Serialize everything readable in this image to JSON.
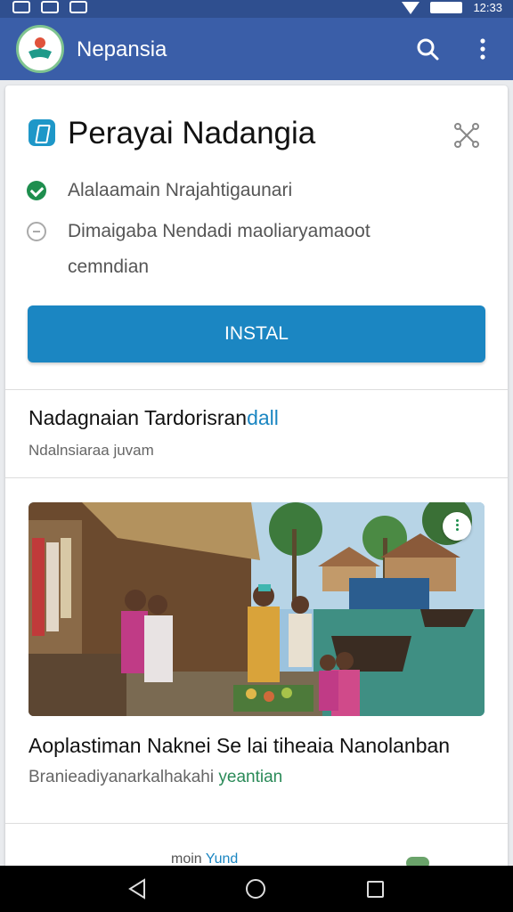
{
  "status_bar": {
    "time": "12:33"
  },
  "app_bar": {
    "title": "Nepansia",
    "icons": [
      "search-icon",
      "more-vert-icon"
    ]
  },
  "card": {
    "title": "Perayai Nadangia",
    "features": [
      {
        "text": "Alalaamain Nrajahtigaunari",
        "status": "checked"
      },
      {
        "text": "Dimaigaba Nendadi maoliaryamaoot cemndian",
        "status": "unchecked"
      }
    ],
    "install_label": "INSTAL"
  },
  "section": {
    "title_main": "Nadagnaian Tardorisran",
    "title_highlight": "dall",
    "subtitle": "Ndalnsiaraa juvam"
  },
  "article": {
    "title": "Aoplastiman Naknei Se lai tiheaia Nanolanban",
    "subtitle_main": "Branieadiyanarkalhakahi",
    "subtitle_highlight": "yeantian"
  },
  "peek": {
    "text_main": "moin",
    "text_highlight": "Yund"
  },
  "colors": {
    "app_bar": "#3a5ea8",
    "accent": "#1b86c2",
    "success": "#1e8e4e"
  }
}
